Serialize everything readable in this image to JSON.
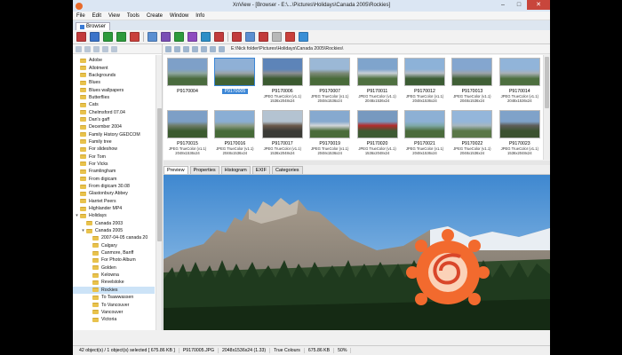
{
  "window": {
    "title": "XnView - [Browser - E:\\...\\Pictures\\Holidays\\Canada 2005\\Rockies]",
    "minimize": "–",
    "maximize": "□",
    "close": "✕"
  },
  "menu": [
    "File",
    "Edit",
    "View",
    "Tools",
    "Create",
    "Window",
    "Info"
  ],
  "tab": {
    "label": "Browser"
  },
  "toolbar": {
    "buttons": [
      {
        "icon": "monitor-icon",
        "color": "#c23b3b"
      },
      {
        "icon": "flag-icon",
        "color": "#3a73c9"
      },
      {
        "icon": "green-arrow-icon",
        "color": "#2e9a3c"
      },
      {
        "icon": "green-arrow-icon",
        "color": "#2e9a3c"
      },
      {
        "icon": "printer-icon",
        "color": "#c9403b"
      },
      {
        "icon": "sep"
      },
      {
        "icon": "monitor-icon",
        "color": "#5b8fd1"
      },
      {
        "icon": "list-icon",
        "color": "#7a4fb5"
      },
      {
        "icon": "image-icon",
        "color": "#2e9a3c"
      },
      {
        "icon": "paint-icon",
        "color": "#8f4bbf"
      },
      {
        "icon": "email-icon",
        "color": "#2e8fc7"
      },
      {
        "icon": "export-icon",
        "color": "#c23b3b"
      },
      {
        "icon": "sep"
      },
      {
        "icon": "slideshow-icon",
        "color": "#c23b3b"
      },
      {
        "icon": "screen-icon",
        "color": "#5b8fd1"
      },
      {
        "icon": "capture-icon",
        "color": "#c23b3b"
      },
      {
        "icon": "clock-icon",
        "color": "#b8b8b8"
      },
      {
        "icon": "settings-icon",
        "color": "#c9403b"
      },
      {
        "icon": "help-icon",
        "color": "#3a8fd6"
      }
    ]
  },
  "path": "E:\\Nick folder\\Pictures\\Holidays\\Canada 2005\\Rockies\\",
  "folders": [
    {
      "label": "Adobe",
      "level": 0
    },
    {
      "label": "Allotment",
      "level": 0
    },
    {
      "label": "Backgrounds",
      "level": 0
    },
    {
      "label": "Blues",
      "level": 0
    },
    {
      "label": "Blues wallpapers",
      "level": 0
    },
    {
      "label": "Butterflies",
      "level": 0
    },
    {
      "label": "Cats",
      "level": 0
    },
    {
      "label": "Chelmsford 07.04",
      "level": 0
    },
    {
      "label": "Dan's gaff",
      "level": 0
    },
    {
      "label": "December 2004",
      "level": 0
    },
    {
      "label": "Family History GEDCOM",
      "level": 0
    },
    {
      "label": "Family tree",
      "level": 0
    },
    {
      "label": "For slideshow",
      "level": 0
    },
    {
      "label": "For Tom",
      "level": 0
    },
    {
      "label": "For Vicks",
      "level": 0
    },
    {
      "label": "Framlingham",
      "level": 0
    },
    {
      "label": "From digicam",
      "level": 0
    },
    {
      "label": "From digicam 30.08",
      "level": 0
    },
    {
      "label": "Glastonbury Abbey",
      "level": 0
    },
    {
      "label": "Harriet Peers",
      "level": 0
    },
    {
      "label": "Highlander MP4",
      "level": 0
    },
    {
      "label": "Holidays",
      "level": 0,
      "expanded": true
    },
    {
      "label": "Canada 2003",
      "level": 1
    },
    {
      "label": "Canada 2005",
      "level": 1,
      "expanded": true
    },
    {
      "label": "2007-04-05 canada 20",
      "level": 2
    },
    {
      "label": "Calgary",
      "level": 2
    },
    {
      "label": "Canmore, Banff",
      "level": 2
    },
    {
      "label": "For Photo Album",
      "level": 2
    },
    {
      "label": "Golden",
      "level": 2
    },
    {
      "label": "Kelowna",
      "level": 2
    },
    {
      "label": "Revelstoke",
      "level": 2
    },
    {
      "label": "Rockies",
      "level": 2,
      "selected": true
    },
    {
      "label": "To Tsawwassen",
      "level": 2
    },
    {
      "label": "To Vancouver",
      "level": 2
    },
    {
      "label": "Vancouver",
      "level": 2
    },
    {
      "label": "Victoria",
      "level": 2
    }
  ],
  "thumbnails": [
    {
      "name": "P9170004",
      "meta1": "",
      "meta2": "",
      "colors": [
        "#7ea0c8",
        "#8fa7a0",
        "#4a6b3e"
      ]
    },
    {
      "name": "P9170005",
      "meta1": "",
      "meta2": "",
      "colors": [
        "#8fb0d6",
        "#9aa3a8",
        "#3f6134"
      ],
      "selected": true
    },
    {
      "name": "P9170006",
      "meta1": "JPEG TrueColor (v1.1)",
      "meta2": "1536x2048x24",
      "colors": [
        "#5d84b8",
        "#8c8f93",
        "#3b5a30"
      ]
    },
    {
      "name": "P9170007",
      "meta1": "JPEG TrueColor (v1.1)",
      "meta2": "2048x1536x24",
      "colors": [
        "#9bb8d6",
        "#7d8a77",
        "#496b3a"
      ]
    },
    {
      "name": "P9170011",
      "meta1": "JPEG TrueColor (v1.1)",
      "meta2": "2048x1536x24",
      "colors": [
        "#7fa4cc",
        "#c9cfd6",
        "#4f7040"
      ]
    },
    {
      "name": "P9170012",
      "meta1": "JPEG TrueColor (v1.1)",
      "meta2": "2048x1536x24",
      "colors": [
        "#8db2d8",
        "#b8bec6",
        "#3c5c34"
      ]
    },
    {
      "name": "P9170013",
      "meta1": "JPEG TrueColor (v1.1)",
      "meta2": "2048x1536x24",
      "colors": [
        "#84a6cf",
        "#9da4a9",
        "#405f36"
      ]
    },
    {
      "name": "P9170014",
      "meta1": "JPEG TrueColor (v1.1)",
      "meta2": "2048x1536x24",
      "colors": [
        "#91b4d9",
        "#a9b0b6",
        "#4d6f3f"
      ]
    },
    {
      "name": "P9170015",
      "meta1": "JPEG TrueColor (v1.1)",
      "meta2": "2048x1536x24",
      "colors": [
        "#7d9fc6",
        "#6e7c6a",
        "#3b5a2f"
      ]
    },
    {
      "name": "P9170016",
      "meta1": "JPEG TrueColor (v1.1)",
      "meta2": "2048x1536x24",
      "colors": [
        "#8aaed4",
        "#8c9b86",
        "#466a38"
      ]
    },
    {
      "name": "P9170017",
      "meta1": "JPEG TrueColor (v1.1)",
      "meta2": "1536x2048x24",
      "colors": [
        "#b4c3d1",
        "#6b5a4c",
        "#3a3a36"
      ]
    },
    {
      "name": "P9170019",
      "meta1": "JPEG TrueColor (v1.1)",
      "meta2": "2048x1536x24",
      "colors": [
        "#86a9cf",
        "#d2d6da",
        "#4a6b3a"
      ]
    },
    {
      "name": "P9170020",
      "meta1": "JPEG TrueColor (v1.1)",
      "meta2": "1536x2048x24",
      "colors": [
        "#7799bf",
        "#b32b2b",
        "#3e5a33"
      ]
    },
    {
      "name": "P9170021",
      "meta1": "JPEG TrueColor (v1.1)",
      "meta2": "2048x1536x24",
      "colors": [
        "#8db0d4",
        "#7fa9a8",
        "#4b6b3c"
      ]
    },
    {
      "name": "P9170022",
      "meta1": "JPEG TrueColor (v1.1)",
      "meta2": "2048x1536x24",
      "colors": [
        "#94b6da",
        "#a7b7bf",
        "#5a7748"
      ]
    },
    {
      "name": "P9170023",
      "meta1": "JPEG TrueColor (v1.1)",
      "meta2": "1536x2048x24",
      "colors": [
        "#7fa2c9",
        "#5d5d58",
        "#3c5230"
      ]
    }
  ],
  "preview_tabs": [
    "Preview",
    "Properties",
    "Histogram",
    "EXIF",
    "Categories"
  ],
  "status": [
    "42 object(s) / 1 object(s) selected  [ 675.86 KB ]",
    "P9170005.JPG",
    "2048x1536x24 (1.33)",
    "True Colours",
    "675.86 KB",
    "50%"
  ],
  "colors": {
    "accent": "#3b86d6",
    "logo": "#f26a2e"
  }
}
